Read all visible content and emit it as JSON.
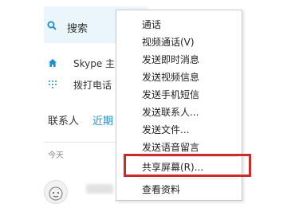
{
  "left_pane": {
    "search_label": "搜索",
    "nav": [
      {
        "icon": "home-icon",
        "label": "Skype 主"
      },
      {
        "icon": "dialpad-icon",
        "label": "拨打电话"
      }
    ],
    "tabs": {
      "contacts": "联系人",
      "recent": "近期"
    },
    "section_today": "今天"
  },
  "context_menu": {
    "items": [
      "通话",
      "视频通话(V)",
      "发送即时消息",
      "发送视频信息",
      "发送手机短信",
      "发送联系人...",
      "发送文件...",
      "发送语音留言",
      "共享屏幕(R)...",
      "查看资料"
    ],
    "highlighted_item": "共享屏幕(R)..."
  },
  "colors": {
    "accent": "#1d90d3",
    "highlight_border": "#cc2b2b",
    "search_bg": "#eaf6fc"
  }
}
